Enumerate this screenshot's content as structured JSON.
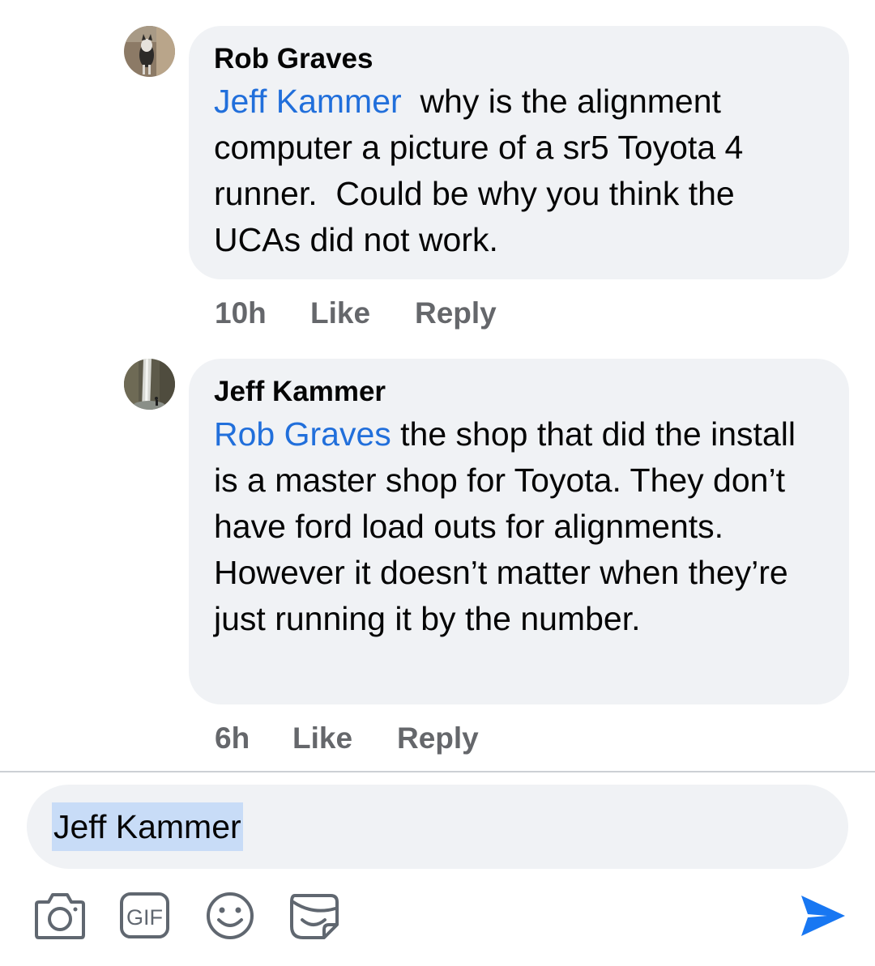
{
  "comments": [
    {
      "author": "Rob Graves",
      "mention": "Jeff Kammer",
      "text": "  why is the alignment computer a picture of a sr5 Toyota 4 runner.  Could be why you think the UCAs did not work.",
      "time": "10h",
      "like_label": "Like",
      "reply_label": "Reply"
    },
    {
      "author": "Jeff Kammer",
      "mention": "Rob Graves",
      "text": " the shop that did the install is a master shop for Toyota. They don’t have ford load outs for alignments. However it doesn’t matter when they’re just running it by the number.",
      "time": "6h",
      "like_label": "Like",
      "reply_label": "Reply"
    }
  ],
  "composer": {
    "value": "Jeff Kammer"
  },
  "toolbar": {
    "gif_label": "GIF",
    "icons": [
      "camera-icon",
      "gif-icon",
      "emoji-icon",
      "sticker-icon",
      "send-icon"
    ]
  },
  "colors": {
    "mention": "#216fdb",
    "bubble": "#f0f2f5",
    "meta": "#65676b",
    "selection": "#c8dcf7",
    "send": "#1877f2"
  }
}
